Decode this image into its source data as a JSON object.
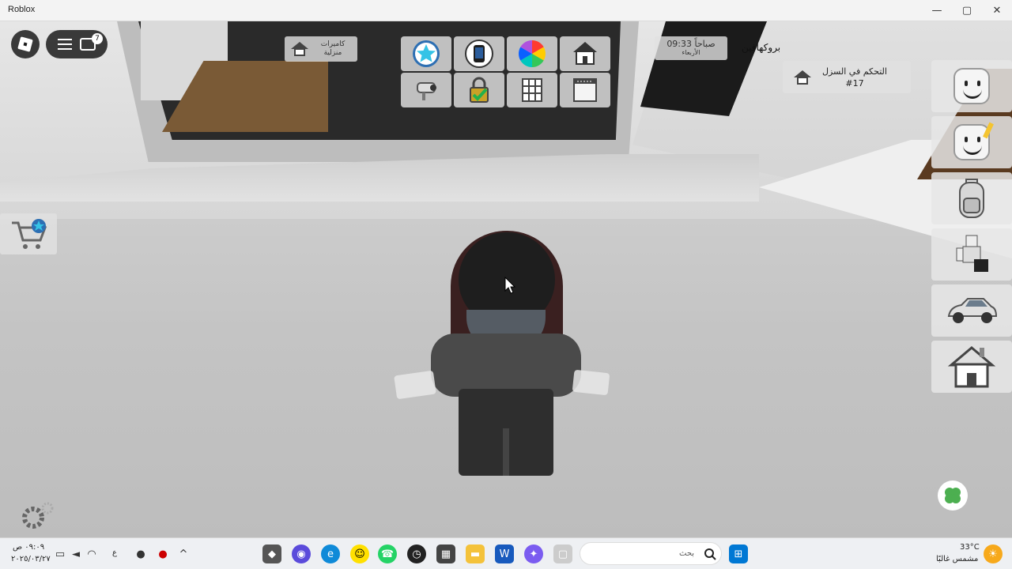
{
  "window": {
    "title": "Roblox",
    "minimize": "—",
    "maximize": "▢",
    "close": "✕"
  },
  "hud": {
    "chat_badge": "7",
    "camera_label": "كاميرات منزلية",
    "time": "09:33 صباحاً",
    "day": "الأربعاء",
    "player_name": "بروكهافين",
    "house_control": "التحكم في السزل",
    "house_number": "#17"
  },
  "icons": {
    "roblox_menu": "roblox-logo-icon",
    "hamburger": "menu-icon",
    "chat": "chat-icon",
    "star": "star-icon",
    "phone": "phone-icon",
    "color_wheel": "color-wheel-icon",
    "house_edit": "house-icon",
    "camera": "security-camera-icon",
    "lock": "lock-icon",
    "window": "window-icon",
    "blinds": "blinds-icon",
    "shop": "shop-cart-icon",
    "settings": "gear-icon",
    "clover": "clover-icon"
  },
  "taskbar": {
    "search_placeholder": "بحث",
    "temperature": "33°C",
    "weather": "مشمس غالبًا",
    "clock_time": "٠٩:٠٩ ص",
    "clock_date": "٢٠٢٥/٠٣/٢٧",
    "lang": "ع"
  },
  "colors": {
    "accent_taskbar": "#0078d4",
    "hud_dark": "#141414"
  }
}
